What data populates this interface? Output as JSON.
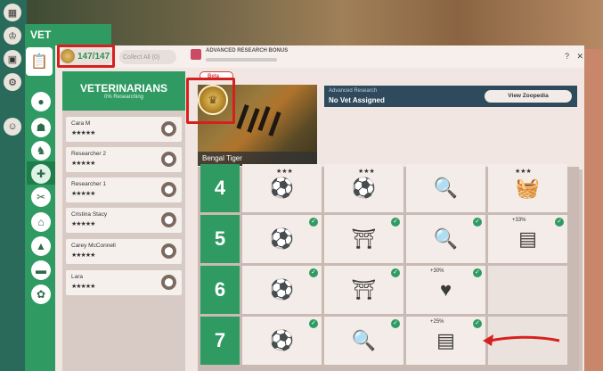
{
  "window": {
    "title": "VET RESEARCH"
  },
  "topbar": {
    "currency": "147/147",
    "collect_all": "Collect All (0)",
    "advanced_bonus": "ADVANCED RESEARCH BONUS",
    "help": "?",
    "close": "✕"
  },
  "vets": {
    "header": "VETERINARIANS",
    "subheader": "0% Researching",
    "list": [
      {
        "name": "Cara M",
        "stars": "★★★★★"
      },
      {
        "name": "Researcher 2",
        "stars": "★★★★★"
      },
      {
        "name": "Researcher 1",
        "stars": "★★★★★"
      },
      {
        "name": "Cristina Stacy",
        "stars": "★★★★★"
      },
      {
        "name": "Carey McConnell",
        "stars": "★★★★★"
      },
      {
        "name": "Lara",
        "stars": "★★★★★"
      }
    ]
  },
  "animal": {
    "name": "Bengal Tiger",
    "tag": "Beta"
  },
  "advanced_research": {
    "label": "Advanced Research",
    "status": "No Vet Assigned",
    "zoopedia_button": "View Zoopedia"
  },
  "levels": [
    {
      "level": "4",
      "cells": [
        {
          "icon": "ball-stars-icon",
          "checked": false,
          "pct": ""
        },
        {
          "icon": "ball-stars-icon",
          "checked": false,
          "pct": ""
        },
        {
          "icon": "magnify-notebook-icon",
          "checked": false,
          "pct": ""
        },
        {
          "icon": "food-tray-stars-icon",
          "checked": false,
          "pct": ""
        }
      ]
    },
    {
      "level": "5",
      "cells": [
        {
          "icon": "ball-stars-icon",
          "checked": true,
          "pct": ""
        },
        {
          "icon": "enrichment-bench-icon",
          "checked": true,
          "pct": ""
        },
        {
          "icon": "magnify-notebook-icon",
          "checked": true,
          "pct": ""
        },
        {
          "icon": "education-board-icon",
          "checked": true,
          "pct": "+33%"
        }
      ]
    },
    {
      "level": "6",
      "cells": [
        {
          "icon": "ball-stars-icon",
          "checked": true,
          "pct": ""
        },
        {
          "icon": "enrichment-bench-icon",
          "checked": true,
          "pct": ""
        },
        {
          "icon": "heart-arrow-icon",
          "checked": true,
          "pct": "+30%"
        },
        {
          "icon": "empty",
          "checked": false,
          "pct": ""
        }
      ]
    },
    {
      "level": "7",
      "cells": [
        {
          "icon": "ball-stars-icon",
          "checked": true,
          "pct": ""
        },
        {
          "icon": "magnify-notebook-icon",
          "checked": true,
          "pct": ""
        },
        {
          "icon": "education-board-icon",
          "checked": true,
          "pct": "+25%"
        },
        {
          "icon": "empty",
          "checked": false,
          "pct": ""
        }
      ]
    }
  ],
  "colors": {
    "green": "#2f9b62",
    "annotation_red": "#d6201f",
    "panel": "#f1e6e1"
  }
}
